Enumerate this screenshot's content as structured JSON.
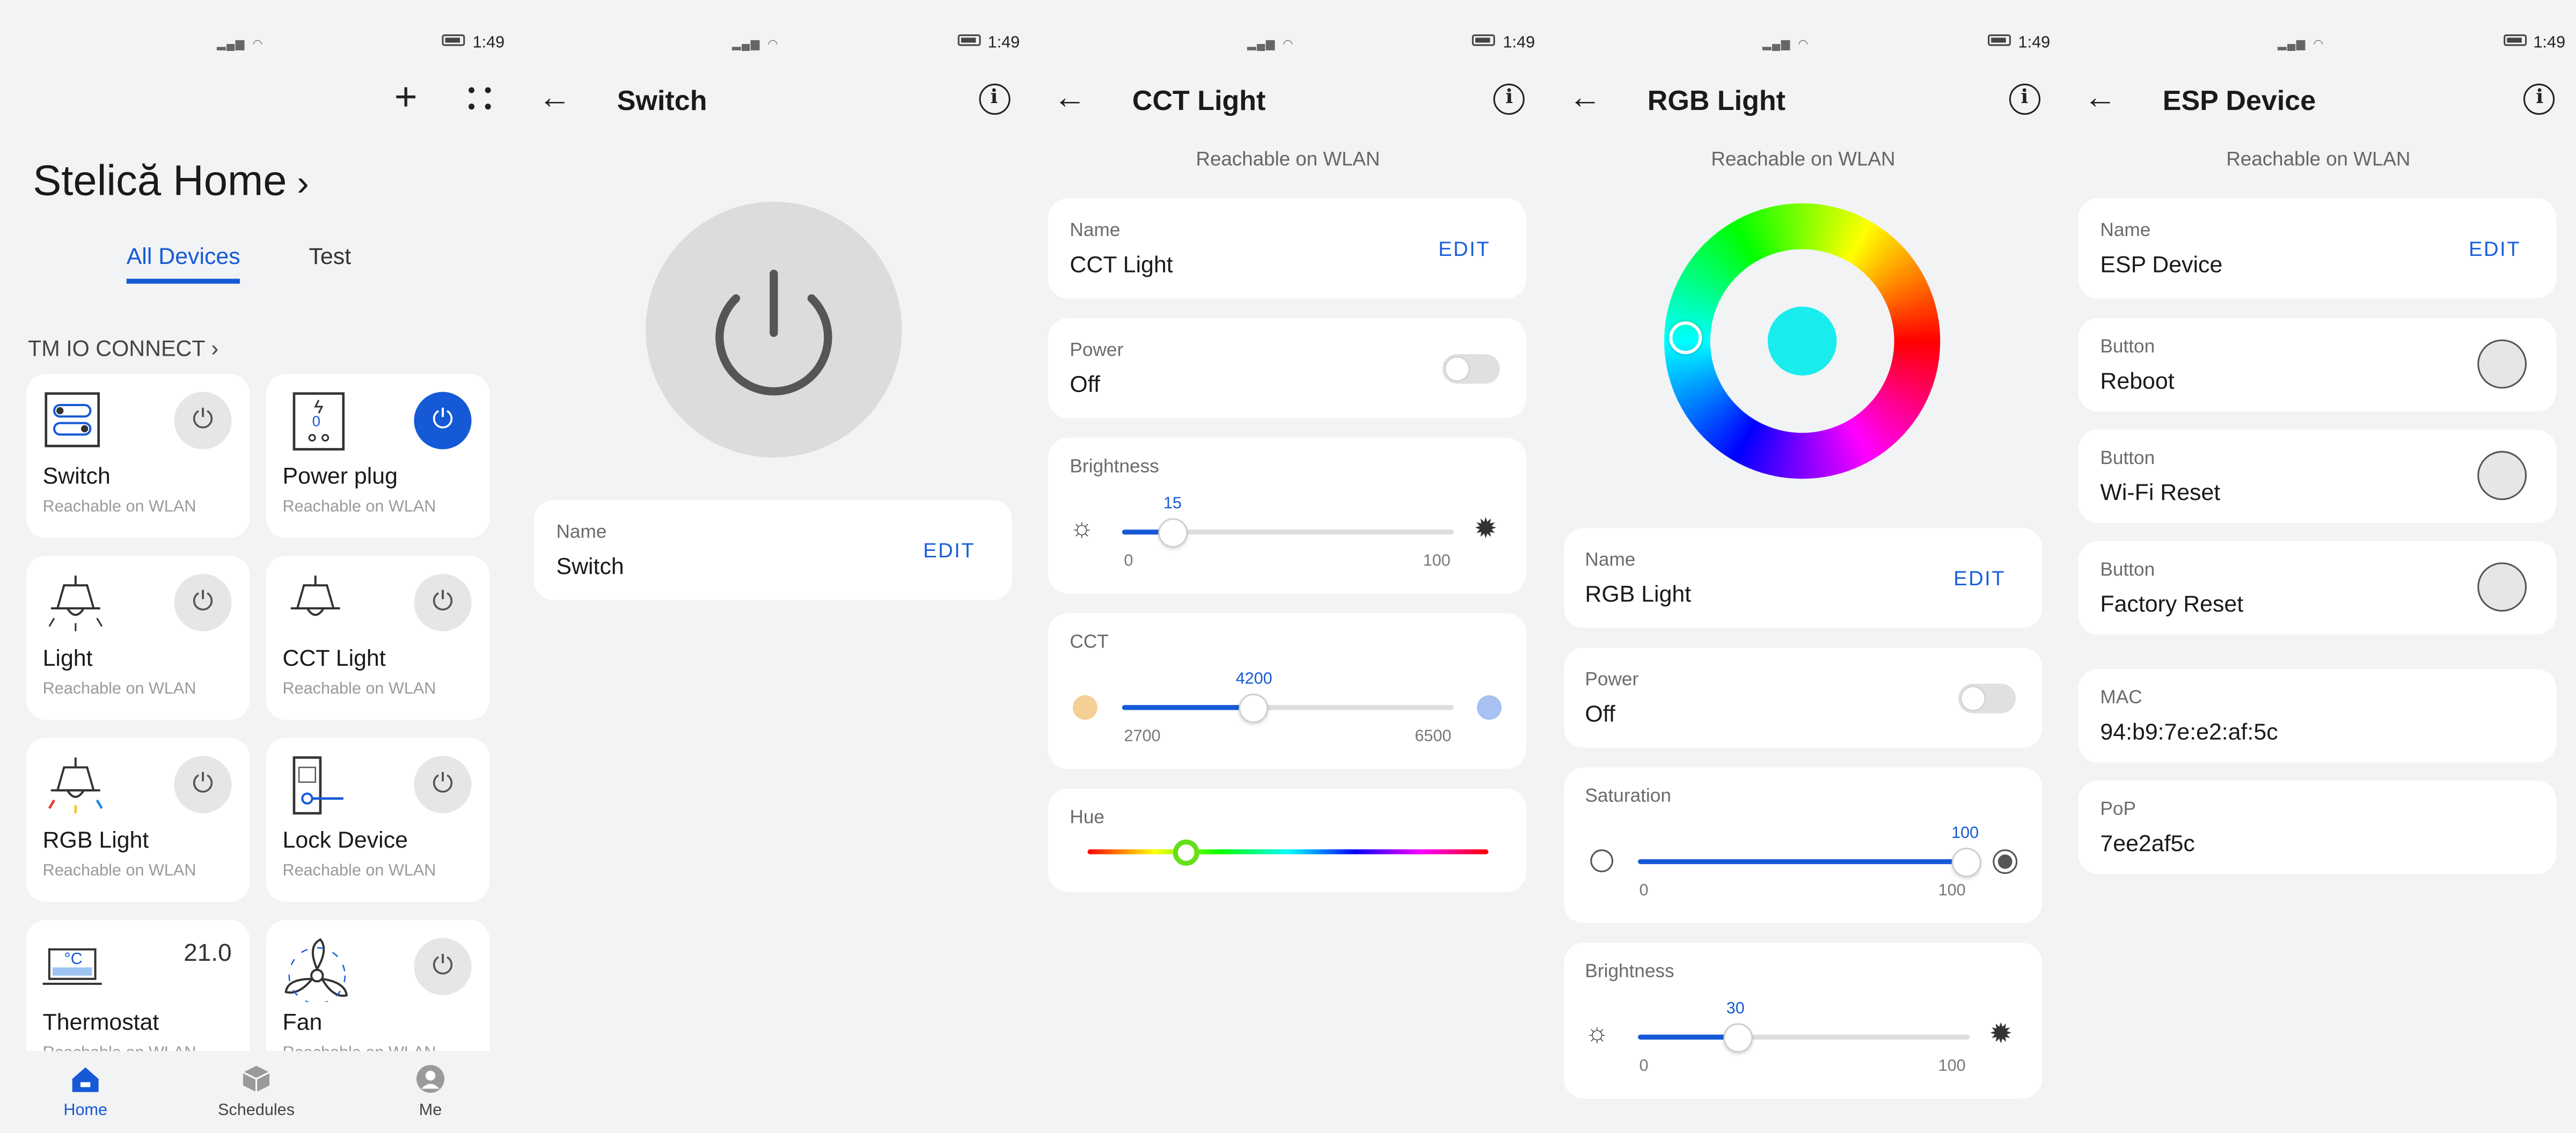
{
  "status_bar": {
    "time": "1:49"
  },
  "home": {
    "title": "Stelică Home",
    "tabs": [
      {
        "label": "All Devices",
        "active": true
      },
      {
        "label": "Test",
        "active": false
      }
    ],
    "group": "TM IO CONNECT",
    "devices": [
      {
        "name": "Switch",
        "status": "Reachable on WLAN",
        "icon": "switch-icon",
        "power_on": false
      },
      {
        "name": "Power plug",
        "status": "Reachable on WLAN",
        "icon": "power-plug-icon",
        "power_on": true,
        "icon_value": "0"
      },
      {
        "name": "Light",
        "status": "Reachable on WLAN",
        "icon": "lamp-icon",
        "power_on": false
      },
      {
        "name": "CCT Light",
        "status": "Reachable on WLAN",
        "icon": "lamp-icon",
        "power_on": false
      },
      {
        "name": "RGB Light",
        "status": "Reachable on WLAN",
        "icon": "rgb-lamp-icon",
        "power_on": false
      },
      {
        "name": "Lock Device",
        "status": "Reachable on WLAN",
        "icon": "lock-icon",
        "power_on": false
      },
      {
        "name": "Thermostat",
        "status": "Reachable on WLAN",
        "icon": "thermostat-icon",
        "reading": "21.0",
        "icon_value": "°C"
      },
      {
        "name": "Fan",
        "status": "Reachable on WLAN",
        "icon": "fan-icon",
        "power_on": false
      }
    ],
    "bottom_nav": [
      {
        "label": "Home",
        "icon": "home-icon",
        "active": true
      },
      {
        "label": "Schedules",
        "icon": "schedules-icon",
        "active": false
      },
      {
        "label": "Me",
        "icon": "profile-icon",
        "active": false
      }
    ]
  },
  "switch_screen": {
    "title": "Switch",
    "name_label": "Name",
    "name_value": "Switch",
    "edit_label": "EDIT"
  },
  "cct_screen": {
    "title": "CCT Light",
    "reachable": "Reachable on WLAN",
    "name_label": "Name",
    "name_value": "CCT Light",
    "edit_label": "EDIT",
    "power_label": "Power",
    "power_value": "Off",
    "brightness": {
      "label": "Brightness",
      "value": "15",
      "min": "0",
      "max": "100"
    },
    "cct": {
      "label": "CCT",
      "value": "4200",
      "min": "2700",
      "max": "6500"
    },
    "hue": {
      "label": "Hue"
    }
  },
  "rgb_screen": {
    "title": "RGB Light",
    "reachable": "Reachable on WLAN",
    "selected_color": "#19ecec",
    "name_label": "Name",
    "name_value": "RGB Light",
    "edit_label": "EDIT",
    "power_label": "Power",
    "power_value": "Off",
    "saturation": {
      "label": "Saturation",
      "value": "100",
      "min": "0",
      "max": "100"
    },
    "brightness": {
      "label": "Brightness",
      "value": "30",
      "min": "0",
      "max": "100"
    }
  },
  "esp_screen": {
    "title": "ESP Device",
    "reachable": "Reachable on WLAN",
    "name_label": "Name",
    "name_value": "ESP Device",
    "edit_label": "EDIT",
    "buttons": [
      {
        "label": "Button",
        "value": "Reboot"
      },
      {
        "label": "Button",
        "value": "Wi-Fi Reset"
      },
      {
        "label": "Button",
        "value": "Factory Reset"
      }
    ],
    "mac_label": "MAC",
    "mac_value": "94:b9:7e:e2:af:5c",
    "pop_label": "PoP",
    "pop_value": "7ee2af5c"
  },
  "colors": {
    "accent": "#1559d6",
    "background": "#f1f3f5",
    "card": "#ffffff"
  }
}
